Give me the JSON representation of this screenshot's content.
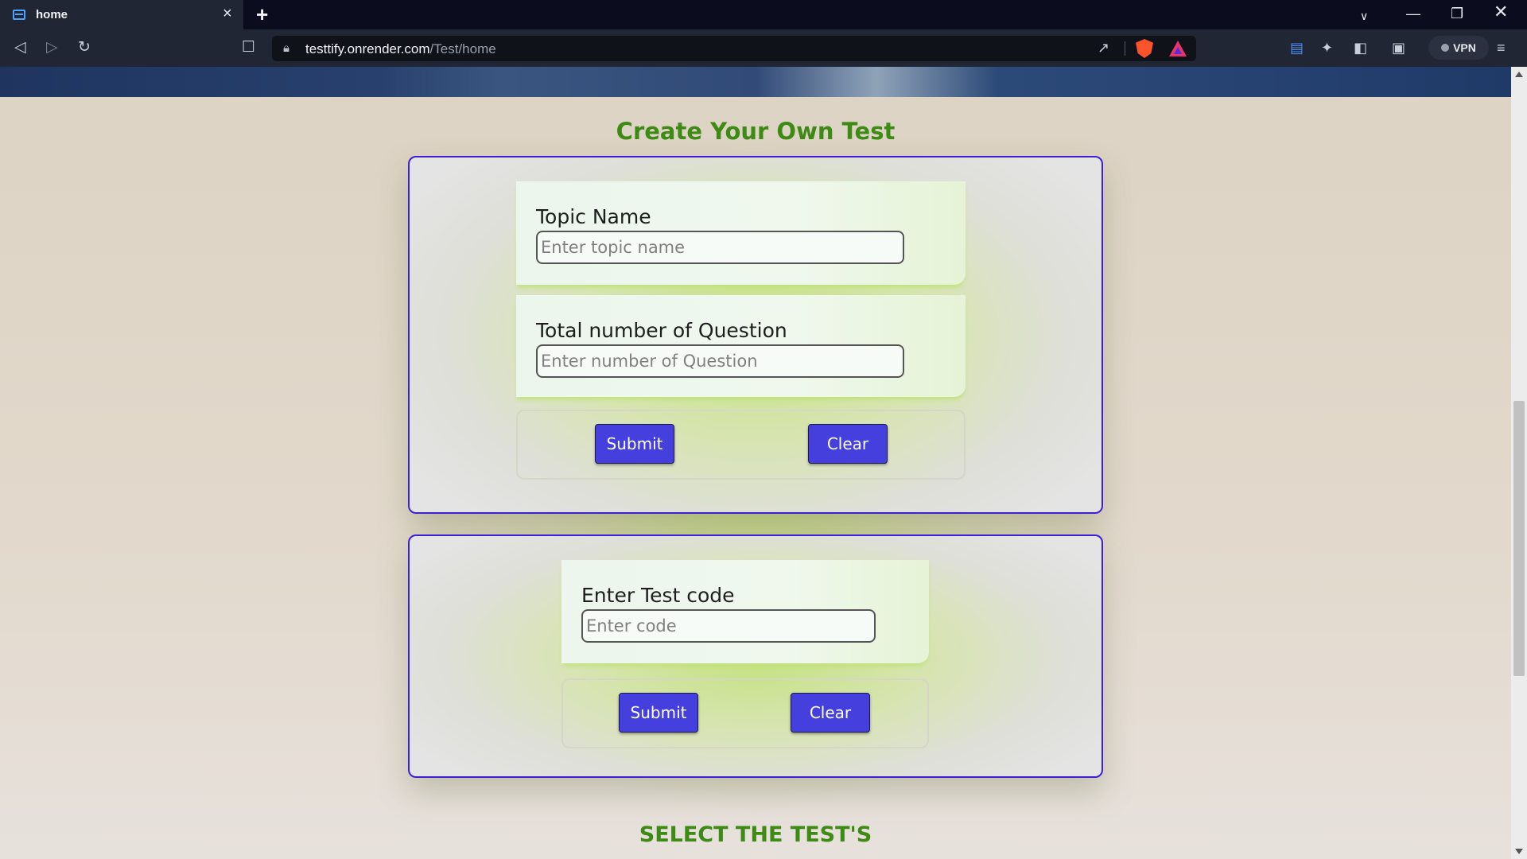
{
  "browser": {
    "tab_title": "home",
    "tab_close_icon": "×",
    "new_tab_icon": "+",
    "url_host": "testtify.onrender.com",
    "url_path": "/Test/home",
    "vpn_label": "VPN"
  },
  "page": {
    "create_heading": "Create Your Own Test",
    "topic": {
      "label": "Topic Name",
      "placeholder": "Enter topic name",
      "value": ""
    },
    "questions": {
      "label": "Total number of Question",
      "placeholder": "Enter number of Question",
      "value": ""
    },
    "create_submit": "Submit",
    "create_clear": "Clear",
    "code": {
      "label": "Enter Test code",
      "placeholder": "Enter code",
      "value": ""
    },
    "code_submit": "Submit",
    "code_clear": "Clear",
    "select_heading": "SELECT THE TEST'S"
  },
  "colors": {
    "heading": "#3d8b14",
    "button": "#4540dd",
    "card_border": "#3d1fd6",
    "browser_chrome": "#202634"
  },
  "icons": [
    "tab-favicon-icon",
    "close-icon",
    "plus-icon",
    "chevron-down-icon",
    "minimize-icon",
    "restore-icon",
    "close-window-icon",
    "back-icon",
    "forward-icon",
    "reload-icon",
    "bookmark-icon",
    "lock-icon",
    "share-icon",
    "brave-shields-icon",
    "brave-rewards-icon",
    "wallet-icon",
    "extensions-icon",
    "sidebar-icon",
    "menu-icon"
  ]
}
